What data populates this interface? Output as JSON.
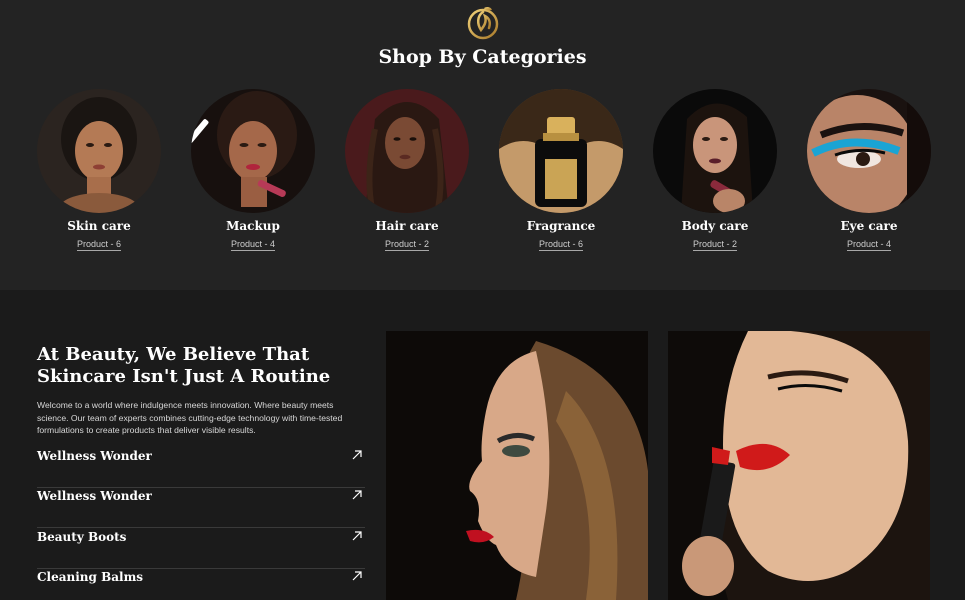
{
  "categories_section": {
    "title": "Shop By Categories",
    "logo_icon": "leaf-face-logo-icon",
    "items": [
      {
        "name": "Skin care",
        "count": "Product - 6"
      },
      {
        "name": "Mackup",
        "count": "Product - 4"
      },
      {
        "name": "Hair care",
        "count": "Product - 2"
      },
      {
        "name": "Fragrance",
        "count": "Product - 6"
      },
      {
        "name": "Body care",
        "count": "Product - 2"
      },
      {
        "name": "Eye care",
        "count": "Product - 4"
      }
    ]
  },
  "about": {
    "title": "At Beauty, We Believe That Skincare Isn't Just A Routine",
    "text": "Welcome to a world where indulgence meets innovation. Where beauty meets science. Our team of experts combines cutting-edge technology with time-tested formulations to create products that deliver visible results.",
    "features": [
      {
        "label": "Wellness Wonder",
        "icon": "arrow-up-right-icon"
      },
      {
        "label": "Wellness Wonder",
        "icon": "arrow-up-right-icon"
      },
      {
        "label": "Beauty Boots",
        "icon": "arrow-up-right-icon"
      },
      {
        "label": "Cleaning Balms",
        "icon": "arrow-up-right-icon"
      }
    ]
  },
  "colors": {
    "top_background": "#232323",
    "bottom_background": "#1b1b1b",
    "accent_gold": "#c9a24a"
  }
}
